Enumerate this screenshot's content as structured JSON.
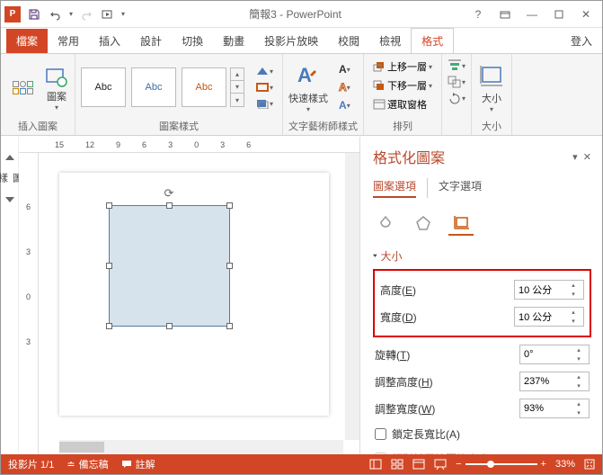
{
  "titlebar": {
    "app_letter": "P",
    "title": "簡報3 - PowerPoint"
  },
  "tabs": {
    "file": "檔案",
    "home": "常用",
    "insert": "插入",
    "design": "設計",
    "transitions": "切換",
    "animations": "動畫",
    "slideshow": "投影片放映",
    "review": "校閱",
    "view": "檢視",
    "format": "格式",
    "signin": "登入"
  },
  "ribbon": {
    "insert_shape": {
      "large_btn": "圖案",
      "label": "插入圖案"
    },
    "shape_styles": {
      "preview": "Abc",
      "label": "圖案樣式"
    },
    "wordart": {
      "large_btn": "快速樣式",
      "label": "文字藝術師樣式"
    },
    "arrange": {
      "bring_forward": "上移一層",
      "send_backward": "下移一層",
      "selection_pane": "選取窗格",
      "label": "排列"
    },
    "size": {
      "large_btn": "大小",
      "label": "大小"
    }
  },
  "ruler": {
    "h": [
      "15",
      "12",
      "9",
      "6",
      "3",
      "0",
      "3",
      "6"
    ],
    "v": [
      "6",
      "3",
      "0",
      "3"
    ]
  },
  "format_pane": {
    "title": "格式化圖案",
    "tab_shape": "圖案選項",
    "tab_text": "文字選項",
    "section_size": "大小",
    "height_label": "高度(",
    "height_key": "E",
    "width_label": "寬度(",
    "width_key": "D",
    "rotation_label": "旋轉(",
    "rotation_key": "T",
    "scale_h_label": "調整高度(",
    "scale_h_key": "H",
    "scale_w_label": "調整寬度(",
    "scale_w_key": "W",
    "lock_ratio": "鎖定長寬比(",
    "lock_ratio_key": "A",
    "relative_orig": "相對於原始圖片大小(",
    "relative_orig_key": "R",
    "height_value": "10 公分",
    "width_value": "10 公分",
    "rotation_value": "0°",
    "scale_h_value": "237%",
    "scale_w_value": "93%"
  },
  "statusbar": {
    "slide": "投影片 1/1",
    "notes": "備忘稿",
    "comments": "註解",
    "zoom": "33%"
  }
}
